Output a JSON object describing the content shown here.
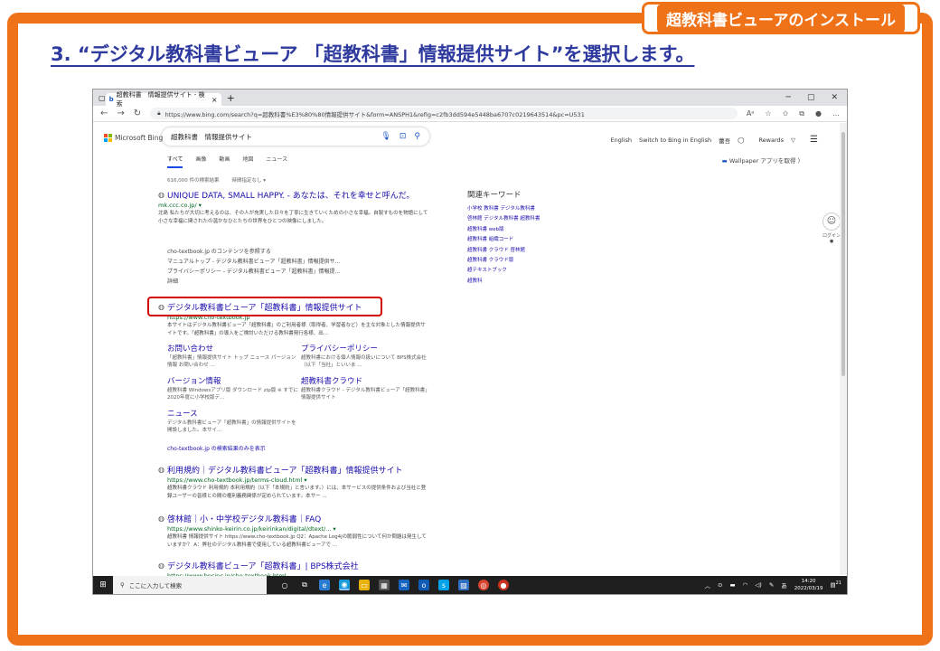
{
  "corner_tab": "超教科書ビューアのインストール",
  "heading": "3. “デジタル教科書ビューア 「超教科書」情報提供サイト”を選択します。",
  "browser": {
    "tab_title": "超教科書　情報提供サイト - 検索",
    "url": "https://www.bing.com/search?q=超教科書%E3%80%80情報提供サイト&form=ANSPH1&refig=c2fb3dd594e5448ba6707c0219643514&pc=U531"
  },
  "bing": {
    "logo_text": "Microsoft Bing",
    "query": "超教科書　情報提供サイト",
    "right_links": [
      "English",
      "Switch to Bing in English",
      "蕾吾",
      "Rewards"
    ],
    "scopes": [
      "すべて",
      "画像",
      "動画",
      "地図",
      "ニュース"
    ],
    "wallpaper_text": "Wallpaper アプリを取得 〉",
    "result_count": "616,000 件の検索結果",
    "time_filter": "時間指定なし ▾"
  },
  "results": [
    {
      "title": "UNIQUE DATA, SMALL HAPPY. - あなたは、それを幸せと呼んだ。",
      "url": "mk.ccc.co.jp/ ▾",
      "snippet": "北島 私たちが大切に考えるのは、その人が充実した日々を丁寧に生きていくための小さな幸福。自製すものを物語にして小さな幸福に関されたの温かなひとたちの世界をひとつの映像にしました。"
    }
  ],
  "deep_links": {
    "header": "cho-textbook.jp のコンテンツを参照する",
    "items": [
      "マニュアルトップ - デジタル教科書ビューア「超教科書」情報提供サ...",
      "プライバシーポリシー - デジタル教科書ビューア「超教科書」情報提...",
      "詳細"
    ]
  },
  "main_result": {
    "title": "デジタル教科書ビューア「超教科書」情報提供サイト",
    "url": "https://www.cho-textbook.jp",
    "snippet": "本サイトはデジタル教科書ビューア「超教科書」のご利用者様（取得者、学習者など）を主な対象とした情報提供サイトです。「超教科書」の導入をご検討いただける教科書発行各様、出..."
  },
  "sitelinks": [
    {
      "title": "お問い合わせ",
      "desc": "「超教科書」情報提供サイト トップ ニュース パージョン情報 お問い合わせ ..."
    },
    {
      "title": "プライバシーポリシー",
      "desc": "超教科書における個人情報の扱いについて BPS株式会社（以下「当社」といいま ..."
    },
    {
      "title": "バージョン情報",
      "desc": "超教科書 Windowsアプリ版 ダウンロード zip版 ※ すでに2020年度に小学校版デ..."
    },
    {
      "title": "超教科書クラウド",
      "desc": "超教科書クラウド - デジタル教科書ビューア「超教科書」情報提供サイト"
    },
    {
      "title": "ニュース",
      "desc": "デジタル教科書ビューア「超教科書」の情報提供サイトを開設しました。本サイ..."
    }
  ],
  "more_from_site": "cho-textbook.jp の検索結果のみを表示",
  "more_results": [
    {
      "title": "利用規約｜デジタル教科書ビューア「超教科書」情報提供サイト",
      "url": "https://www.cho-textbook.jp/terms-cloud.html ▾",
      "snippet": "超教科書クラウド 利用規約 本利用規約（以下「本規約」と言います。）には、本サービスの提供条件および当社と登録ユーザーの皆様との間の権利義務関係が定められています。本サー ..."
    },
    {
      "title": "啓林館｜小・中学校デジタル教科書｜FAQ",
      "url": "https://www.shinko-keirin.co.jp/keirinkan/digital/dtext/... ▾",
      "snippet": "超教科書 情報提供サイト https://www.cho-textbook.jp Q2：Apache Log4jの脆弱性について何か問題は発生していますか？ A：弊社のデジタル教科書で使用している超教科書ビューアで ..."
    },
    {
      "title": "デジタル教科書ビューア「超教科書」| BPS株式会社",
      "url": "https://www.bpsinc.jp/cho-textbook.html"
    }
  ],
  "related": {
    "header": "関連キーワード",
    "items": [
      "小学校 教科書 デジタル教科書",
      "啓林館 デジタル教科書 超教科書",
      "超教科書 web版",
      "超教科書 組織コード",
      "超教科書 クラウド 啓林館",
      "超教科書 クラウド版",
      "超テキストブック",
      "超教科"
    ]
  },
  "avatar_label": "ログイン ●",
  "taskbar": {
    "search_placeholder": "ここに入力して検索",
    "ime": "あ",
    "time": "14:20",
    "date": "2022/03/19",
    "notif": "21"
  }
}
